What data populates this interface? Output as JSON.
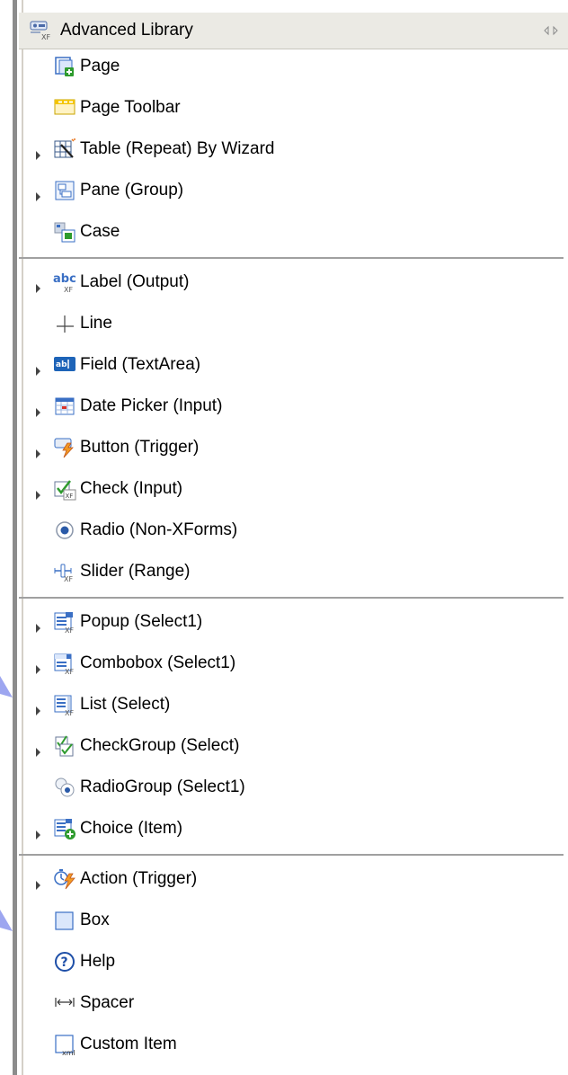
{
  "drawer": {
    "title": "Advanced Library",
    "sections": [
      {
        "items": [
          {
            "label": "Page",
            "icon": "page-icon",
            "expandable": false
          },
          {
            "label": "Page Toolbar",
            "icon": "toolbar-icon",
            "expandable": false
          },
          {
            "label": "Table (Repeat) By Wizard",
            "icon": "table-wizard-icon",
            "expandable": true
          },
          {
            "label": "Pane (Group)",
            "icon": "pane-icon",
            "expandable": true
          },
          {
            "label": "Case",
            "icon": "case-icon",
            "expandable": false
          }
        ]
      },
      {
        "items": [
          {
            "label": "Label (Output)",
            "icon": "label-output-icon",
            "expandable": true
          },
          {
            "label": "Line",
            "icon": "line-icon",
            "expandable": false
          },
          {
            "label": "Field (TextArea)",
            "icon": "textarea-icon",
            "expandable": true
          },
          {
            "label": "Date Picker (Input)",
            "icon": "date-picker-icon",
            "expandable": true
          },
          {
            "label": "Button (Trigger)",
            "icon": "button-trigger-icon",
            "expandable": true
          },
          {
            "label": "Check (Input)",
            "icon": "checkbox-icon",
            "expandable": true
          },
          {
            "label": "Radio (Non-XForms)",
            "icon": "radio-icon",
            "expandable": false
          },
          {
            "label": "Slider (Range)",
            "icon": "slider-icon",
            "expandable": false
          }
        ]
      },
      {
        "items": [
          {
            "label": "Popup (Select1)",
            "icon": "popup-icon",
            "expandable": true
          },
          {
            "label": "Combobox (Select1)",
            "icon": "combobox-icon",
            "expandable": true
          },
          {
            "label": "List (Select)",
            "icon": "list-icon",
            "expandable": true
          },
          {
            "label": "CheckGroup (Select)",
            "icon": "checkgroup-icon",
            "expandable": true
          },
          {
            "label": "RadioGroup (Select1)",
            "icon": "radiogroup-icon",
            "expandable": false
          },
          {
            "label": "Choice (Item)",
            "icon": "choice-icon",
            "expandable": true
          }
        ]
      },
      {
        "items": [
          {
            "label": "Action (Trigger)",
            "icon": "action-icon",
            "expandable": true
          },
          {
            "label": "Box",
            "icon": "box-icon",
            "expandable": false
          },
          {
            "label": "Help",
            "icon": "help-icon",
            "expandable": false
          },
          {
            "label": "Spacer",
            "icon": "spacer-icon",
            "expandable": false
          },
          {
            "label": "Custom Item",
            "icon": "custom-item-icon",
            "expandable": false
          }
        ]
      }
    ]
  },
  "colors": {
    "header_bg": "#ebeae4",
    "separator": "#a0a0a0",
    "accent_blue": "#3a6fc4",
    "accent_green": "#2e9b2e",
    "accent_orange": "#e8741b"
  }
}
